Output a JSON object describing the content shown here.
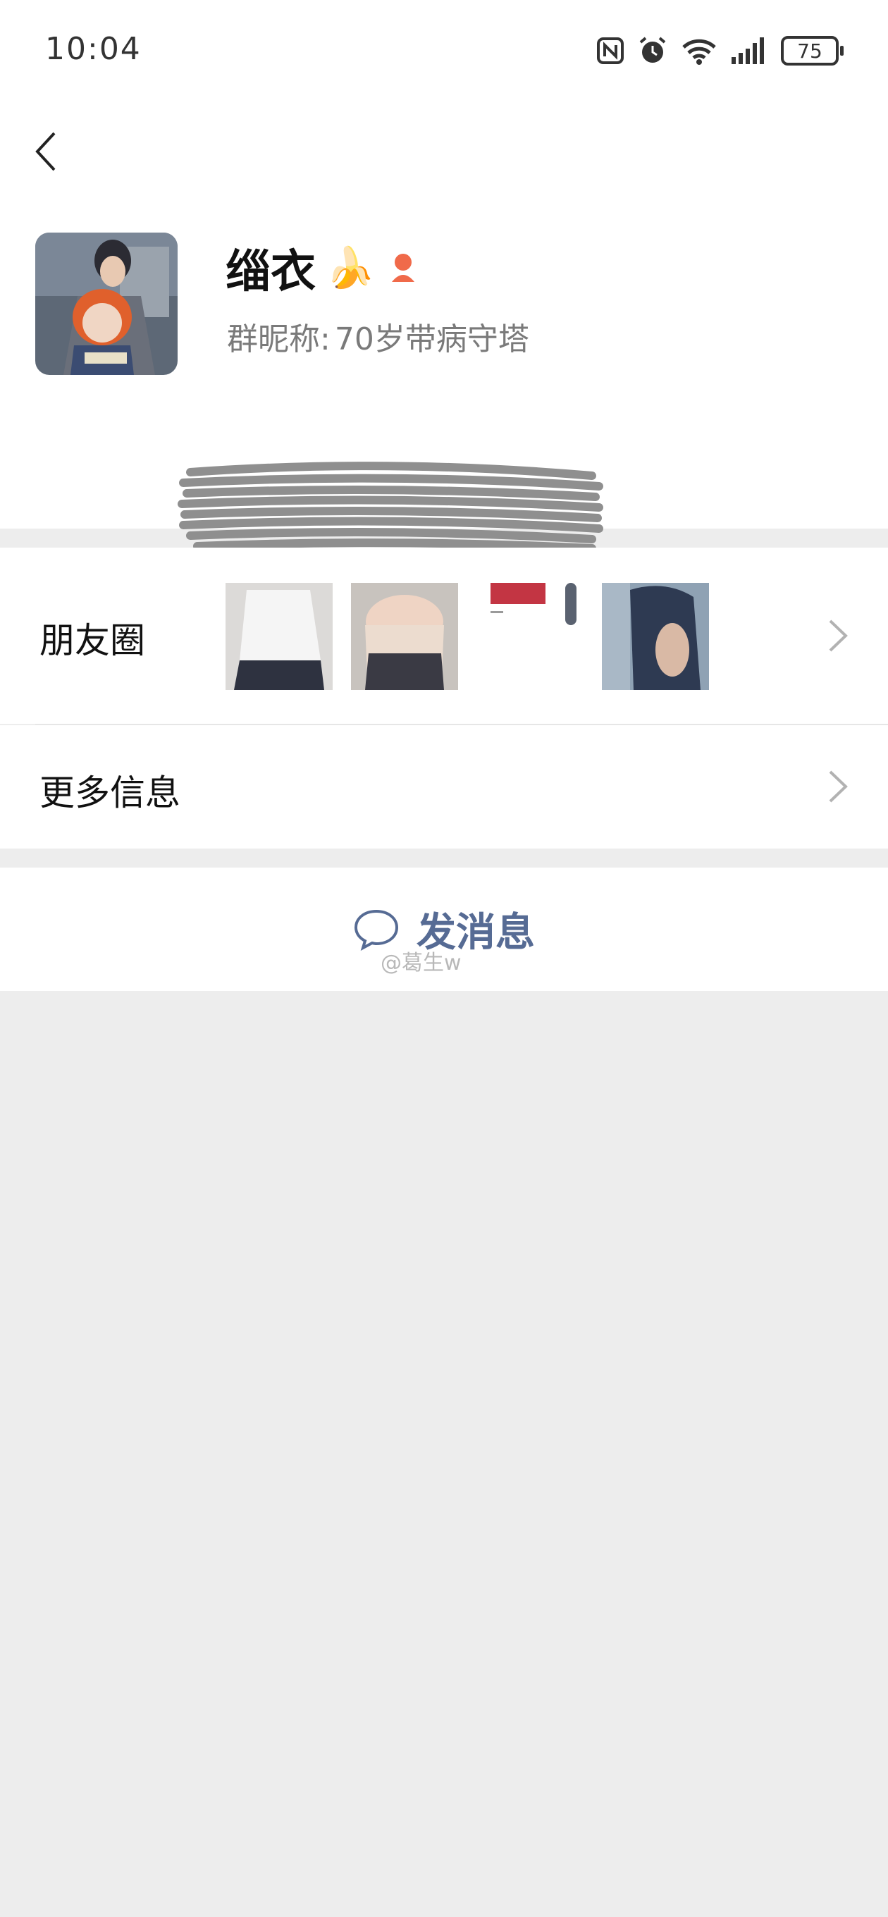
{
  "status": {
    "time": "10:04",
    "battery": "75"
  },
  "profile": {
    "name": "缁衣",
    "name_emoji": "🍌",
    "nickname_label": "群昵称:",
    "nickname_value": "70岁带病守塔"
  },
  "moments": {
    "label": "朋友圈"
  },
  "more_info": {
    "label": "更多信息"
  },
  "send_message": {
    "label": "发消息"
  },
  "watermark": "@葛生w",
  "colors": {
    "accent": "#566b94",
    "background": "#ededed",
    "badge": "#f06a4a"
  }
}
